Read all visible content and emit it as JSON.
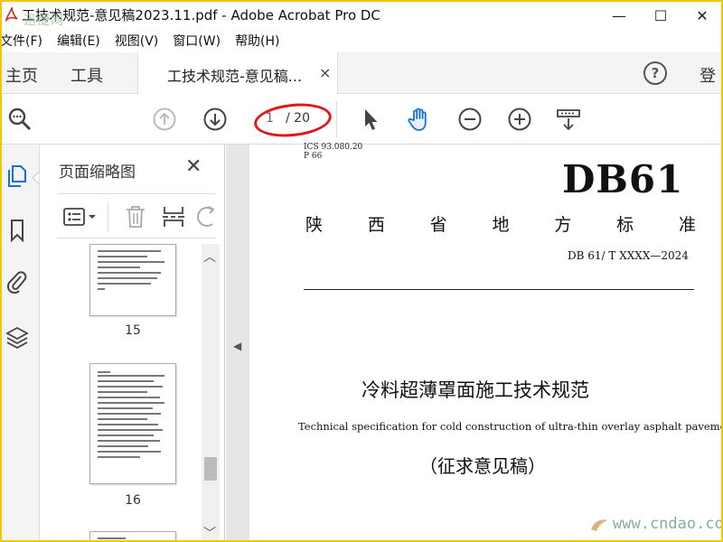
{
  "window": {
    "title": "工技术规范-意见稿2023.11.pdf - Adobe Acrobat Pro DC",
    "watermark": "迅捷网"
  },
  "menubar": {
    "items": [
      "文件(F)",
      "编辑(E)",
      "视图(V)",
      "窗口(W)",
      "帮助(H)"
    ]
  },
  "tabs": {
    "home": "主页",
    "tools": "工具",
    "document": "工技术规范-意见稿...",
    "close": "×",
    "login": "登"
  },
  "toolbar": {
    "current_page": "1",
    "total_pages": "/ 20"
  },
  "thumbnail_panel": {
    "title": "页面缩略图",
    "close": "✕",
    "pages": [
      {
        "number": "15"
      },
      {
        "number": "16"
      }
    ]
  },
  "document": {
    "ics": "ICS  93.080.20",
    "pcode": "P 66",
    "logo": "DB61",
    "heading_chars": [
      "陕",
      "西",
      "省",
      "地",
      "方",
      "标",
      "准"
    ],
    "std_number": "DB 61/ T XXXX—2024",
    "title": "冷料超薄罩面施工技术规范",
    "subtitle": "Technical specification for cold construction of ultra-thin overlay asphalt pavement",
    "status": "（征求意见稿）"
  },
  "site_watermark": "www.cndao.com",
  "colors": {
    "border": "#f2c600",
    "oval": "#e01818",
    "accent_blue": "#1a6fd6"
  }
}
